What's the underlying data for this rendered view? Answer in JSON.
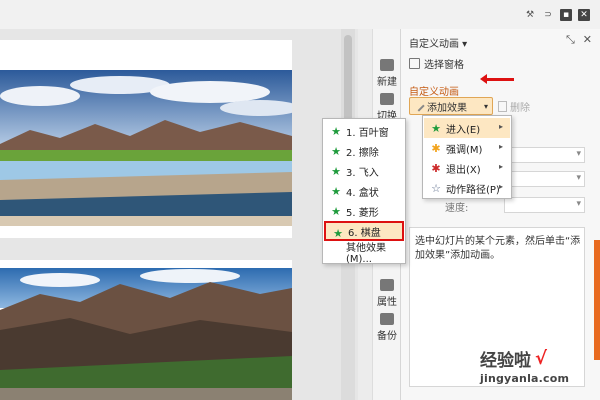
{
  "pane": {
    "title": "自定义动画 ▾",
    "select_pane": "选择窗格",
    "section_title": "自定义动画",
    "add_effect": "添加效果",
    "delete": "删除",
    "desc_text": "选中幻灯片的某个元素，然后单击“添加效果”添加动画。",
    "field_label": "速度:"
  },
  "tools": [
    "新建",
    "切换",
    "属性",
    "备份"
  ],
  "effect_menu": [
    {
      "label": "进入(E)",
      "icon": "star-green-icon",
      "has_submenu": true
    },
    {
      "label": "强调(M)",
      "icon": "star-orange-icon",
      "has_submenu": true
    },
    {
      "label": "退出(X)",
      "icon": "star-red-icon",
      "has_submenu": true
    },
    {
      "label": "动作路径(P)",
      "icon": "star-outline-icon",
      "has_submenu": true
    }
  ],
  "entrance_menu": [
    {
      "label": "1. 百叶窗",
      "icon": "star-green-icon"
    },
    {
      "label": "2. 擦除",
      "icon": "star-green-icon"
    },
    {
      "label": "3. 飞入",
      "icon": "star-green-icon"
    },
    {
      "label": "4. 盒状",
      "icon": "star-green-icon"
    },
    {
      "label": "5. 菱形",
      "icon": "star-green-icon"
    },
    {
      "label": "6. 棋盘",
      "icon": "star-green-icon"
    },
    {
      "label": "其他效果(M)...",
      "icon": ""
    }
  ],
  "watermark": {
    "title": "经验啦",
    "url": "jingyanla.com",
    "check": "√"
  },
  "colors": {
    "highlight": "#fde7c2",
    "accent_red": "#dd1111",
    "section_orange": "#c55a11"
  }
}
